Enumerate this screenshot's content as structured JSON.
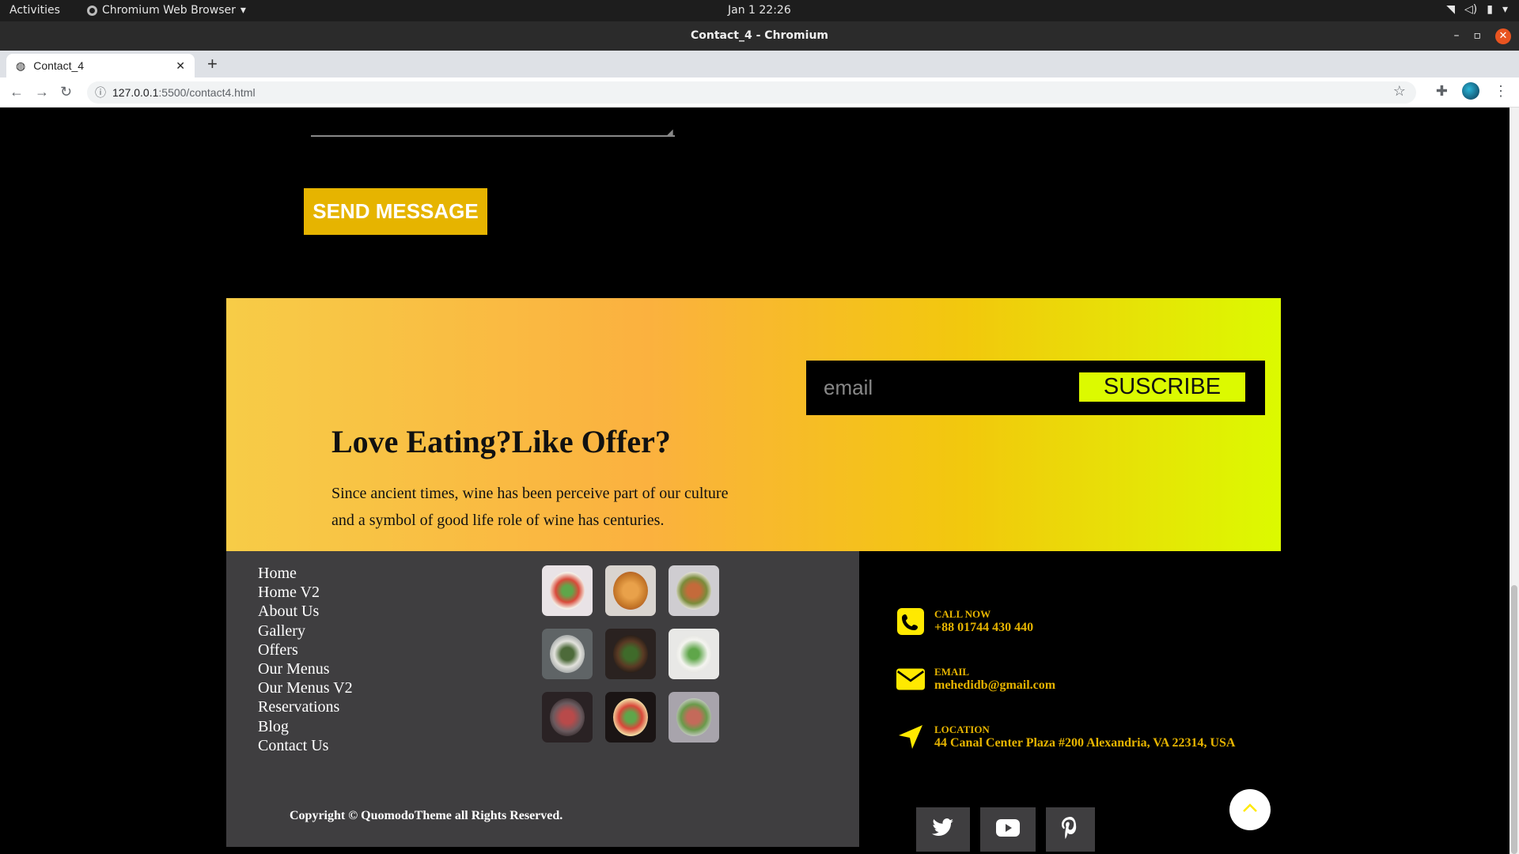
{
  "os": {
    "activities": "Activities",
    "app_name": "Chromium Web Browser",
    "clock": "Jan 1  22:26"
  },
  "window": {
    "title": "Contact_4 - Chromium"
  },
  "browser": {
    "tab_title": "Contact_4",
    "url_host": "127.0.0.1",
    "url_rest": ":5500/contact4.html"
  },
  "form": {
    "send_label": "SEND MESSAGE"
  },
  "offer": {
    "heading": "Love Eating?Like Offer?",
    "text": "Since ancient times, wine has been perceive part of our culture and a symbol of good life role of wine has centuries.",
    "email_placeholder": "email",
    "subscribe_label": "SUSCRIBE"
  },
  "footer": {
    "links": [
      "Home",
      "Home V2",
      "About Us",
      "Gallery",
      "Offers",
      "Our Menus",
      "Our Menus V2",
      "Reservations",
      "Blog",
      "Contact Us"
    ],
    "copyright": "Copyright © QuomodoTheme all Rights Reserved.",
    "contacts": [
      {
        "label": "CALL NOW",
        "value": "+88 01744 430 440",
        "icon": "phone-icon"
      },
      {
        "label": "EMAIL",
        "value": "mehedidb@gmail.com",
        "icon": "envelope-icon"
      },
      {
        "label": "LOCATION",
        "value": "44 Canal Center Plaza #200 Alexandria, VA 22314, USA",
        "icon": "location-arrow-icon"
      }
    ],
    "social": [
      "twitter-icon",
      "youtube-icon",
      "pinterest-icon"
    ]
  },
  "colors": {
    "accent": "#e6b400",
    "lime": "#dcfa00",
    "footer_bg": "#3f3e40"
  }
}
